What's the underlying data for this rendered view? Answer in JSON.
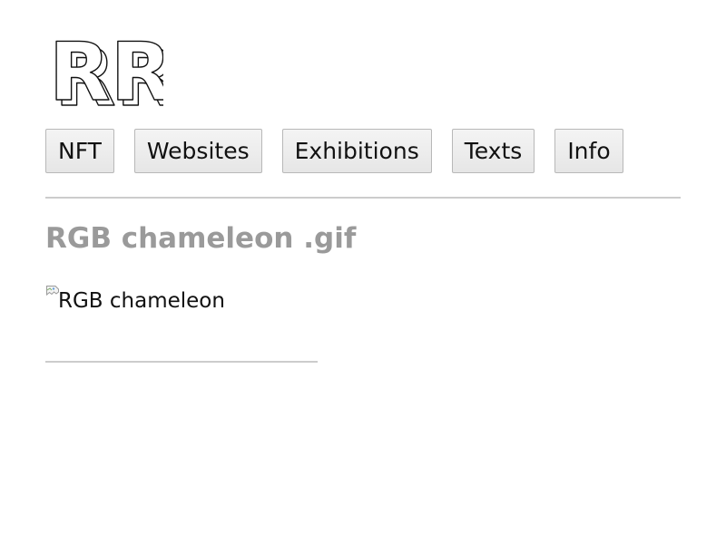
{
  "logo": {
    "text": "RR"
  },
  "nav": {
    "items": [
      {
        "label": "NFT"
      },
      {
        "label": "Websites"
      },
      {
        "label": "Exhibitions"
      },
      {
        "label": "Texts"
      },
      {
        "label": "Info"
      }
    ]
  },
  "page": {
    "title": "RGB chameleon .gif",
    "image_alt": "RGB chameleon"
  },
  "colors": {
    "title": "#9a9a9a",
    "rule": "#cccccc",
    "button_border": "#b8b8b8",
    "button_bg": "#ececec"
  }
}
